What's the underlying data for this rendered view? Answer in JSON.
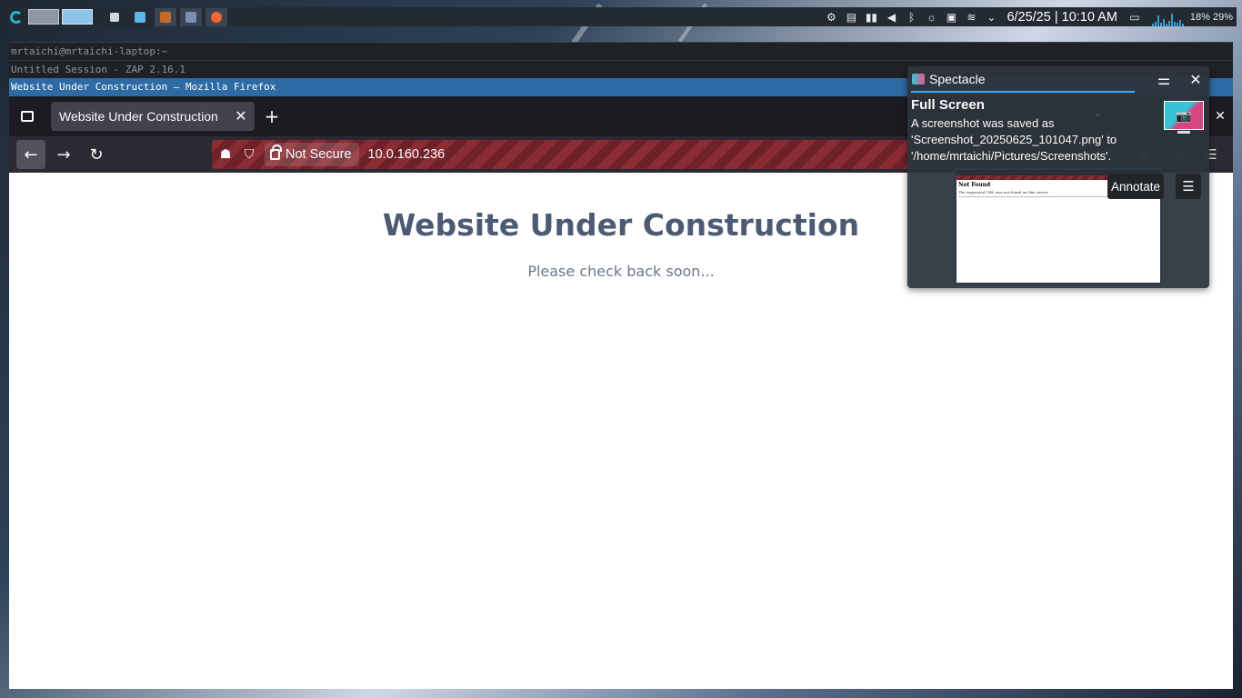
{
  "panel": {
    "clock": "6/25/25 | 10:10 AM",
    "load": "18% 29%",
    "icons": [
      "app-launcher-icon",
      "desktop-pager-icon",
      "task-manager-icon",
      "file-manager-icon",
      "zap-icon",
      "krita-icon",
      "firefox-icon",
      "display-icon",
      "clipboard-icon",
      "media-icon",
      "volume-icon",
      "bluetooth-icon",
      "brightness-icon",
      "battery-icon",
      "wifi-icon",
      "tray-expand-icon",
      "show-desktop-icon",
      "system-monitor-icon"
    ]
  },
  "windows": {
    "terminal_title": "mrtaichi@mrtaichi-laptop:~",
    "zap_title": "Untitled Session - ZAP 2.16.1",
    "firefox_title": "Website Under Construction — Mozilla Firefox"
  },
  "browser": {
    "tab_title": "Website Under Construction",
    "tab_close": "✕",
    "new_tab": "+",
    "not_secure": "Not Secure",
    "url": "10.0.160.236"
  },
  "page": {
    "title": "Website Under Construction",
    "subtitle": "Please check back soon..."
  },
  "notification": {
    "app_name": "Spectacle",
    "title": "Full Screen",
    "body": "A screenshot was saved as 'Screenshot_20250625_101047.png' to '/home/mrtaichi/Pictures/Screenshots'.",
    "annotate_label": "Annotate",
    "preview_heading": "Not Found",
    "preview_text": "The requested URL was not found on this server."
  },
  "colors": {
    "accent": "#3daee9",
    "firefox_dark": "#2b2a33",
    "page_title": "#4c5a73",
    "not_secure_stripes": "#8a2d33"
  }
}
